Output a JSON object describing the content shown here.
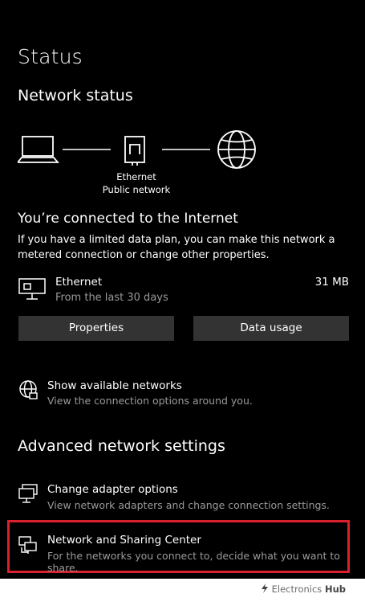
{
  "header": {
    "title": "Status"
  },
  "network_status": {
    "title": "Network status",
    "diagram": {
      "line1": "Ethernet",
      "line2": "Public network"
    }
  },
  "connection": {
    "title": "You’re connected to the Internet",
    "description": "If you have a limited data plan, you can make this network a metered connection or change other properties.",
    "adapter_name": "Ethernet",
    "adapter_period": "From the last 30 days",
    "usage": "31 MB",
    "properties_label": "Properties",
    "data_usage_label": "Data usage"
  },
  "show_networks": {
    "title": "Show available networks",
    "subtitle": "View the connection options around you."
  },
  "advanced": {
    "title": "Advanced network settings",
    "items": [
      {
        "title": "Change adapter options",
        "subtitle": "View network adapters and change connection settings.",
        "icon": "adapter-icon"
      },
      {
        "title": "Network and Sharing Center",
        "subtitle": "For the networks you connect to, decide what you want to share.",
        "icon": "sharing-center-icon"
      }
    ]
  },
  "watermark": {
    "brand_a": "Electronics",
    "brand_b": "Hub"
  },
  "colors": {
    "background": "#000000",
    "button": "#333333",
    "highlight": "#d8202f",
    "muted": "#9a9a9a"
  }
}
